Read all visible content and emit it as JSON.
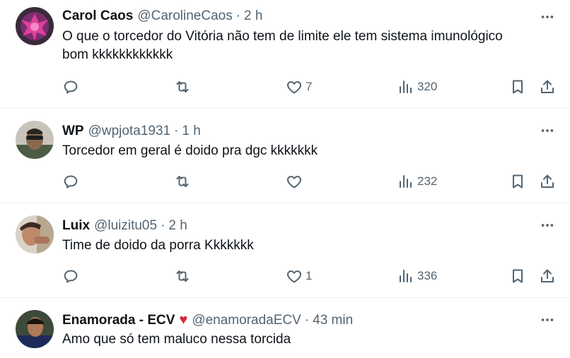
{
  "tweets": [
    {
      "name": "Carol Caos",
      "handle": "@CarolineCaos",
      "time": "2 h",
      "text_lines": [
        "O que o torcedor do Vitória não tem de limite ele tem sistema imunológico",
        "bom kkkkkkkkkkkk"
      ],
      "likes": "7",
      "views": "320"
    },
    {
      "name": "WP",
      "handle": "@wpjota1931",
      "time": "1 h",
      "text_lines": [
        "Torcedor em geral é doido pra dgc kkkkkkk"
      ],
      "likes": "",
      "views": "232"
    },
    {
      "name": "Luix",
      "handle": "@luizitu05",
      "time": "2 h",
      "text_lines": [
        "Time de doido da porra Kkkkkkk"
      ],
      "likes": "1",
      "views": "336"
    },
    {
      "name": "Enamorada - ECV",
      "handle": "@enamoradaECV",
      "time": "43 min",
      "text_lines": [
        "Amo que só tem maluco nessa torcida"
      ]
    }
  ],
  "separator": "·",
  "heart_badge": "♥",
  "icons": {
    "more": "more-icon",
    "reply": "reply-icon",
    "retweet": "retweet-icon",
    "like": "heart-icon",
    "views": "views-icon",
    "bookmark": "bookmark-icon",
    "share": "share-icon"
  },
  "colors": {
    "text": "#0f1419",
    "secondary": "#536471",
    "divider": "#eff3f4",
    "heart_badge": "#d1293d"
  }
}
